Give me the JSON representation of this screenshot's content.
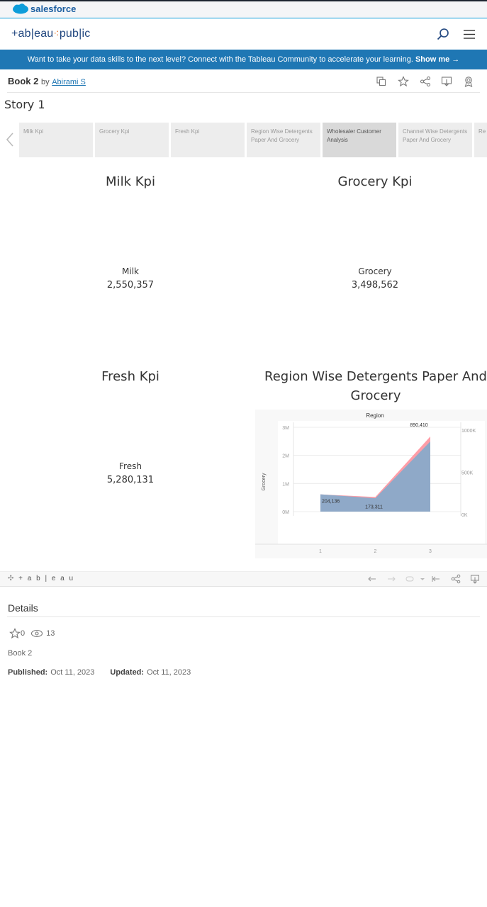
{
  "brand": {
    "salesforce": "salesforce",
    "tableau_public_1": "+ab|eau",
    "tableau_public_2": "pub|ic"
  },
  "banner": {
    "text": "Want to take your data skills to the next level? Connect with the Tableau Community to accelerate your learning.",
    "cta": "Show me →"
  },
  "book": {
    "title": "Book 2",
    "by": "by",
    "author": "Abirami S"
  },
  "story": {
    "title": "Story 1",
    "tabs": [
      {
        "label": "Milk Kpi"
      },
      {
        "label": "Grocery Kpi"
      },
      {
        "label": "Fresh Kpi"
      },
      {
        "label": "Region Wise Detergents Paper And Grocery"
      },
      {
        "label": "Wholesaler Customer Analysis"
      },
      {
        "label": "Channel Wise Detergents Paper And Grocery"
      },
      {
        "label": "Re"
      }
    ]
  },
  "kpis": {
    "milk": {
      "title": "Milk Kpi",
      "label": "Milk",
      "value": "2,550,357"
    },
    "grocery": {
      "title": "Grocery Kpi",
      "label": "Grocery",
      "value": "3,498,562"
    },
    "fresh": {
      "title": "Fresh Kpi",
      "label": "Fresh",
      "value": "5,280,131"
    }
  },
  "chart_data": {
    "type": "area",
    "title": "Region Wise Detergents Paper And Grocery",
    "header": "Region",
    "x": [
      1,
      2,
      3
    ],
    "xlabel": "",
    "ylabel": "Grocery",
    "ylim": [
      0,
      3000000
    ],
    "y_ticks": [
      "0M",
      "1M",
      "2M",
      "3M"
    ],
    "y2lim": [
      0,
      1000000
    ],
    "y2_ticks": [
      "0K",
      "500K",
      "1000K"
    ],
    "series": [
      {
        "values": [
          204136,
          173311,
          890410
        ],
        "color": "#ff9da7",
        "axis": "right"
      },
      {
        "values": [
          615000,
          476000,
          2497000
        ],
        "color": "#8fa9c8",
        "axis": "left"
      }
    ],
    "data_labels": [
      {
        "x": 1,
        "text": "204,136"
      },
      {
        "x": 2,
        "text": "173,311"
      },
      {
        "x": 3,
        "text": "890,410"
      }
    ],
    "grid": true
  },
  "toolbar": {
    "logo": "+ a b | e a u"
  },
  "details": {
    "title": "Details",
    "favorites": "0",
    "views": "13",
    "book_name": "Book 2",
    "published_label": "Published:",
    "published": "Oct 11, 2023",
    "updated_label": "Updated:",
    "updated": "Oct 11, 2023"
  },
  "colors": {
    "banner": "#1f77b4",
    "brand_blue": "#1f457e",
    "accent_orange": "#e8762b"
  }
}
